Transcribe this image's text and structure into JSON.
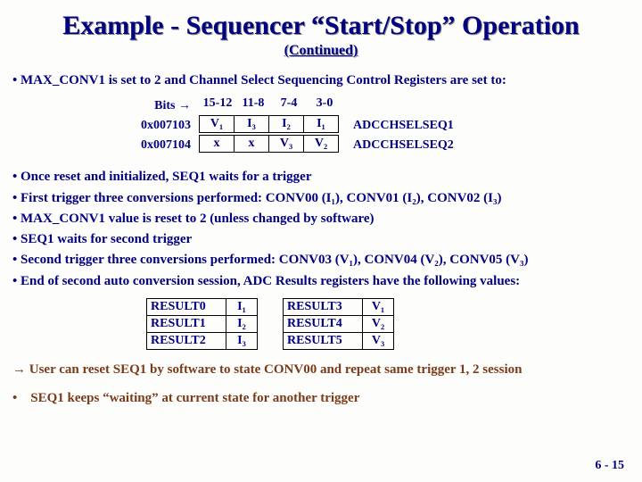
{
  "title": "Example - Sequencer “Start/Stop” Operation",
  "subtitle": "(Continued)",
  "intro": "• MAX_CONV1 is set to 2 and Channel Select Sequencing Control  Registers are set to:",
  "bitsLabel": "Bits →",
  "headers": {
    "h1": "15-12",
    "h2": "11-8",
    "h3": "7-4",
    "h4": "3-0"
  },
  "rows": [
    {
      "addr": "0x007103",
      "cells": [
        "V₁",
        "I₃",
        "I₂",
        "I₁"
      ],
      "after": "ADCCHSELSEQ1"
    },
    {
      "addr": "0x007104",
      "cells": [
        "x",
        "x",
        "V₃",
        "V₂"
      ],
      "after": "ADCCHSELSEQ2"
    }
  ],
  "mid": [
    "• Once reset and initialized, SEQ1 waits for a trigger",
    "• First trigger three conversions performed: CONV00 (I₁), CONV01 (I₂), CONV02 (I₃)",
    "• MAX_CONV1 value is reset to 2 (unless changed by software)",
    "• SEQ1 waits for second trigger",
    "• Second trigger three conversions performed: CONV03 (V₁), CONV04 (V₂), CONV05 (V₃)",
    "• End of second auto conversion session, ADC Results registers have the following values:"
  ],
  "results": {
    "left": [
      {
        "l": "RESULT0",
        "v": "I₁"
      },
      {
        "l": "RESULT1",
        "v": "I₂"
      },
      {
        "l": "RESULT2",
        "v": "I₃"
      }
    ],
    "right": [
      {
        "l": "RESULT3",
        "v": "V₁"
      },
      {
        "l": "RESULT4",
        "v": "V₂"
      },
      {
        "l": "RESULT5",
        "v": "V₃"
      }
    ]
  },
  "footnote1": "→ User can reset SEQ1 by software to state CONV00 and repeat same trigger 1, 2 session",
  "footnote2": "• SEQ1 keeps “waiting” at current state for another trigger",
  "pagenum": "6 - 15"
}
